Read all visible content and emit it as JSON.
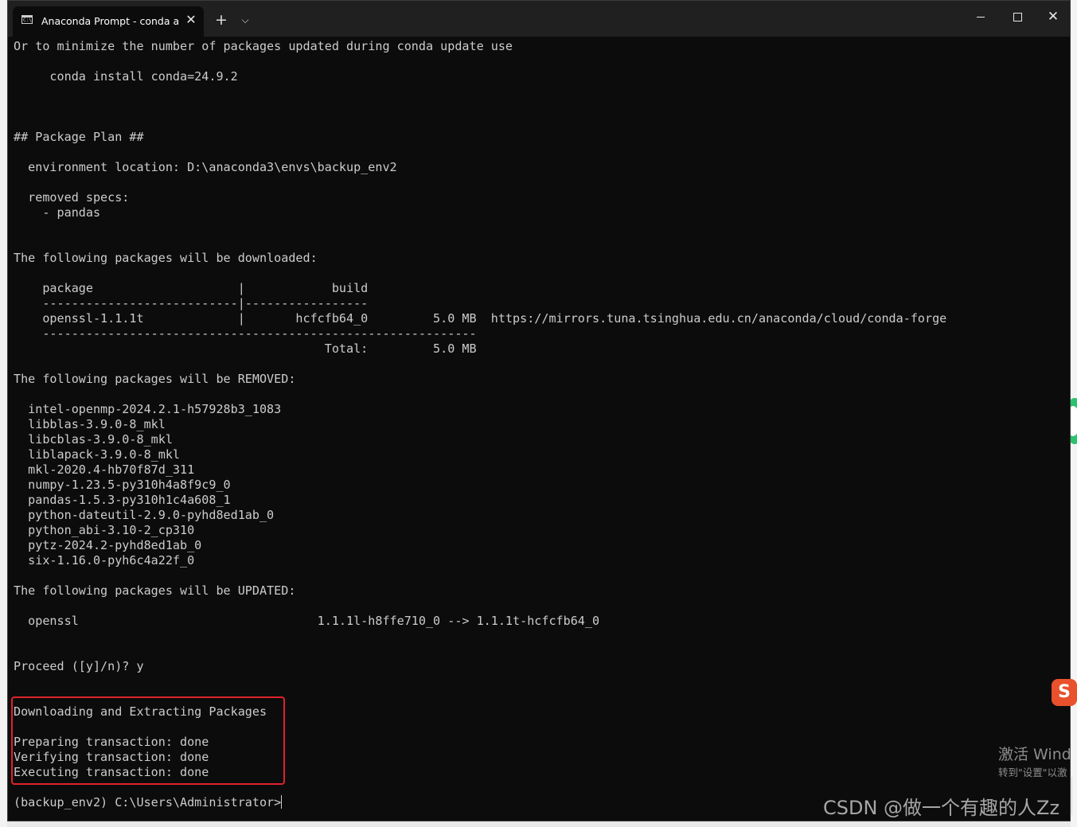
{
  "window": {
    "tab_title": "Anaconda Prompt - conda  ac",
    "tab_icon": "console-icon",
    "new_tab_glyph": "+",
    "dropdown_glyph": "⌵",
    "close_tab_glyph": "✕",
    "close_glyph": "✕"
  },
  "console": {
    "lines": [
      "Or to minimize the number of packages updated during conda update use",
      "",
      "     conda install conda=24.9.2",
      "",
      "",
      "",
      "## Package Plan ##",
      "",
      "  environment location: D:\\anaconda3\\envs\\backup_env2",
      "",
      "  removed specs:",
      "    - pandas",
      "",
      "",
      "The following packages will be downloaded:",
      "",
      "    package                    |            build",
      "    ---------------------------|-----------------",
      "    openssl-1.1.1t             |       hcfcfb64_0         5.0 MB  https://mirrors.tuna.tsinghua.edu.cn/anaconda/cloud/conda-forge",
      "    ------------------------------------------------------------",
      "                                           Total:         5.0 MB",
      "",
      "The following packages will be REMOVED:",
      "",
      "  intel-openmp-2024.2.1-h57928b3_1083",
      "  libblas-3.9.0-8_mkl",
      "  libcblas-3.9.0-8_mkl",
      "  liblapack-3.9.0-8_mkl",
      "  mkl-2020.4-hb70f87d_311",
      "  numpy-1.23.5-py310h4a8f9c9_0",
      "  pandas-1.5.3-py310h1c4a608_1",
      "  python-dateutil-2.9.0-pyhd8ed1ab_0",
      "  python_abi-3.10-2_cp310",
      "  pytz-2024.2-pyhd8ed1ab_0",
      "  six-1.16.0-pyh6c4a22f_0",
      "",
      "The following packages will be UPDATED:",
      "",
      "  openssl                                 1.1.1l-h8ffe710_0 --> 1.1.1t-hcfcfb64_0",
      "",
      "",
      "Proceed ([y]/n)? y",
      "",
      "",
      "Downloading and Extracting Packages",
      "",
      "Preparing transaction: done",
      "Verifying transaction: done",
      "Executing transaction: done",
      ""
    ],
    "prompt": "(backup_env2) C:\\Users\\Administrator>"
  },
  "overlay": {
    "activate_windows": "激活 Wind",
    "activate_hint": "转到\"设置\"以激",
    "watermark": "CSDN @做一个有趣的人Zz",
    "sogou_glyph": "S"
  }
}
